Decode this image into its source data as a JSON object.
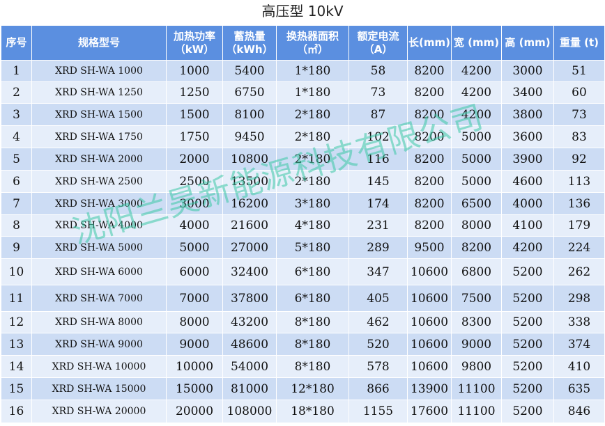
{
  "title": "高压型 10kV",
  "headers": [
    {
      "line1": "序号",
      "line2": ""
    },
    {
      "line1": "规格型号",
      "line2": ""
    },
    {
      "line1": "加热功率",
      "line2": "（kW）"
    },
    {
      "line1": "蓄热量",
      "line2": "（kWh）"
    },
    {
      "line1": "换热器面积",
      "line2": "（㎡）"
    },
    {
      "line1": "额定电流",
      "line2": "（A）"
    },
    {
      "line1": "长(mm)",
      "line2": ""
    },
    {
      "line1": "宽 (mm)",
      "line2": ""
    },
    {
      "line1": "高 (mm)",
      "line2": ""
    },
    {
      "line1": "重量 (t)",
      "line2": ""
    }
  ],
  "rows": [
    [
      "1",
      "XRD SH-WA 1000",
      "1000",
      "5400",
      "1*180",
      "58",
      "8200",
      "4200",
      "3000",
      "51"
    ],
    [
      "2",
      "XRD SH-WA 1250",
      "1250",
      "6750",
      "1*180",
      "73",
      "8200",
      "4200",
      "3400",
      "60"
    ],
    [
      "3",
      "XRD SH-WA 1500",
      "1500",
      "8100",
      "2*180",
      "87",
      "8200",
      "4200",
      "3800",
      "73"
    ],
    [
      "4",
      "XRD SH-WA 1750",
      "1750",
      "9450",
      "2*180",
      "102",
      "8200",
      "5000",
      "3600",
      "83"
    ],
    [
      "5",
      "XRD SH-WA 2000",
      "2000",
      "10800",
      "2*180",
      "116",
      "8200",
      "5000",
      "3900",
      "92"
    ],
    [
      "6",
      "XRD SH-WA 2500",
      "2500",
      "13500",
      "2*180",
      "145",
      "8200",
      "5000",
      "4600",
      "113"
    ],
    [
      "7",
      "XRD SH-WA 3000",
      "3000",
      "16200",
      "3*180",
      "174",
      "8200",
      "6500",
      "4000",
      "136"
    ],
    [
      "8",
      "XRD SH-WA 4000",
      "4000",
      "21600",
      "4*180",
      "231",
      "8200",
      "8000",
      "4100",
      "179"
    ],
    [
      "9",
      "XRD SH-WA 5000",
      "5000",
      "27000",
      "5*180",
      "289",
      "9500",
      "8200",
      "4200",
      "224"
    ],
    [
      "10",
      "XRD SH-WA 6000",
      "6000",
      "32400",
      "6*180",
      "347",
      "10600",
      "6800",
      "5200",
      "262"
    ],
    [
      "11",
      "XRD SH-WA 7000",
      "7000",
      "37800",
      "6*180",
      "405",
      "10600",
      "7500",
      "5200",
      "298"
    ],
    [
      "12",
      "XRD SH-WA 8000",
      "8000",
      "43200",
      "8*180",
      "462",
      "10600",
      "8300",
      "5200",
      "338"
    ],
    [
      "13",
      "XRD SH-WA 9000",
      "9000",
      "48600",
      "8*180",
      "520",
      "10600",
      "9000",
      "5200",
      "374"
    ],
    [
      "14",
      "XRD SH-WA 10000",
      "10000",
      "54000",
      "8*180",
      "578",
      "10600",
      "9800",
      "5200",
      "410"
    ],
    [
      "15",
      "XRD SH-WA 15000",
      "15000",
      "81000",
      "12*180",
      "866",
      "13900",
      "11100",
      "5200",
      "635"
    ],
    [
      "16",
      "XRD SH-WA 20000",
      "20000",
      "108000",
      "18*180",
      "1155",
      "17600",
      "11100",
      "5200",
      "846"
    ]
  ],
  "watermark": "沈阳兰昊新能源科技有限公司"
}
